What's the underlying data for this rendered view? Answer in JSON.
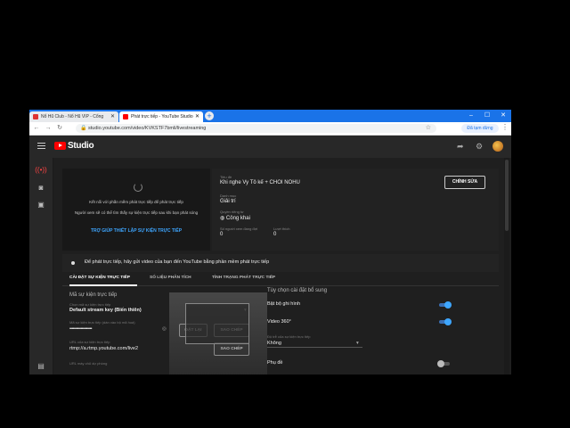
{
  "browser": {
    "tabs": [
      {
        "title": "Nổ Hũ Club - Nổ Hũ VIP - Cổng"
      },
      {
        "title": "Phát trực tiếp - YouTube Studio"
      }
    ],
    "url": "studio.youtube.com/video/KVKSTF7bmli/livestreaming",
    "account_label": "Đã tạm dừng"
  },
  "studio": {
    "brand": "Studio"
  },
  "preview": {
    "msg1": "Kết nối với phần mềm phát trực tiếp để phát trực tiếp",
    "msg2": "Người xem sẽ có thể tìm thấy sự kiện trực tiếp sau khi bạn phát sóng",
    "help_link": "TRỢ GIÚP THIẾT LẬP SỰ KIỆN TRỰC TIẾP"
  },
  "info": {
    "title_label": "Tiêu đề",
    "title_value": "Khi nghe Vy Tô kế + CHOI NOHU",
    "category_label": "Danh mục",
    "category_value": "Giải trí",
    "privacy_label": "Quyền riêng tư",
    "privacy_value": "Công khai",
    "viewers_label": "Số người xem đang đợi",
    "viewers_value": "0",
    "likes_label": "Lượt thích",
    "likes_value": "0",
    "edit_label": "CHỈNH SỬA"
  },
  "notice": "Để phát trực tiếp, hãy gửi video của bạn đến YouTube bằng phần mềm phát trực tiếp",
  "tabs": [
    {
      "label": "CÀI ĐẶT SỰ KIỆN TRỰC TIẾP"
    },
    {
      "label": "SỐ LIỆU PHÂN TÍCH"
    },
    {
      "label": "TÌNH TRẠNG PHÁT TRỰC TIẾP"
    }
  ],
  "settings": {
    "key_heading": "Mã sự kiện trực tiếp",
    "key_select_label": "Chọn mã sự kiện trực tiếp",
    "key_select_value": "Default stream key (Biến thiên)",
    "key_label": "Mã sự kiện trực tiếp (dán vào bộ mã hoá)",
    "key_value": "••••••••••••••••••••",
    "reset_label": "ĐẶT LẠI",
    "copy_label": "SAO CHÉP",
    "url_label": "URL của sự kiện trực tiếp",
    "url_value": "rtmp://a.rtmp.youtube.com/live2",
    "copy2_label": "SAO CHÉP",
    "backup_label": "URL máy chủ dự phòng",
    "extra_heading": "Tùy chọn cài đặt bổ sung",
    "dvr_label": "Bật bộ ghi hình",
    "video360_label": "Video 360°",
    "delay_label": "Độ trễ của sự kiện trực tiếp",
    "delay_value": "Không",
    "subtitle_label": "Phụ đề"
  }
}
